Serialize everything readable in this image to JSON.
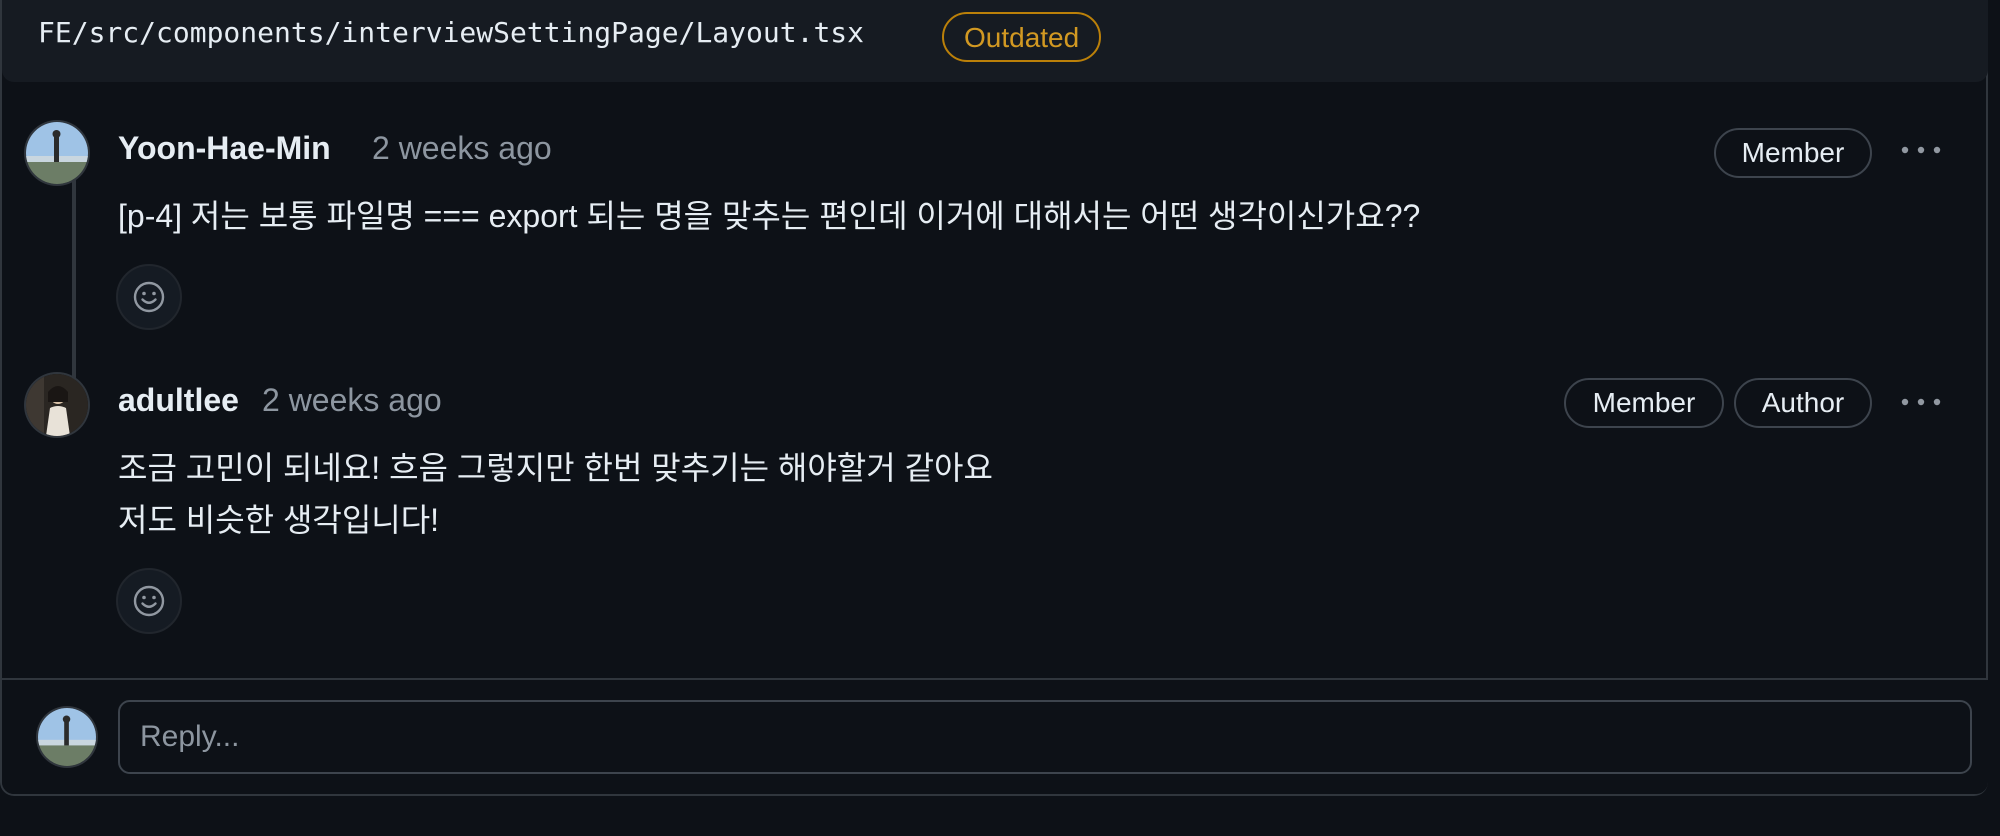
{
  "file": {
    "path": "FE/src/components/interviewSettingPage/Layout.tsx",
    "status_badge": "Outdated"
  },
  "comments": [
    {
      "author": "Yoon-Hae-Min",
      "time": "2 weeks ago",
      "badges": [
        "Member"
      ],
      "lines": [
        "[p-4] 저는 보통 파일명 === export 되는 명을 맞추는 편인데 이거에 대해서는 어떤 생각이신가요??"
      ]
    },
    {
      "author": "adultlee",
      "time": "2 weeks ago",
      "badges": [
        "Member",
        "Author"
      ],
      "lines": [
        "조금 고민이 되네요! 흐음 그렇지만 한번 맞추기는 해야할거 같아요",
        "저도 비슷한 생각입니다!"
      ]
    }
  ],
  "reply": {
    "placeholder": "Reply..."
  },
  "icons": {
    "more": "kebab-horizontal-icon",
    "reaction": "smiley-icon"
  },
  "colors": {
    "background": "#0d1117",
    "header": "#161b22",
    "outdated": "#d29922",
    "muted": "#8d96a0"
  }
}
